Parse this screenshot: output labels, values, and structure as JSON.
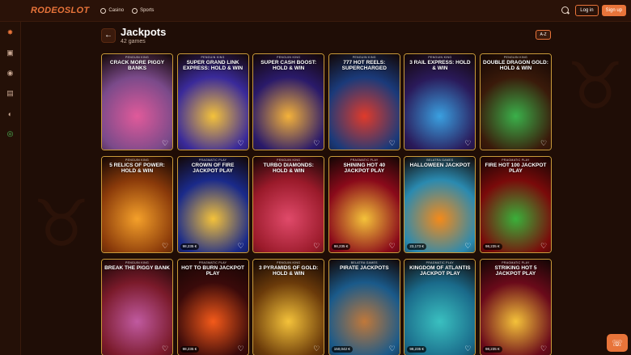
{
  "app": {
    "logo": "RODEOSLOT"
  },
  "nav": [
    {
      "label": "Casino"
    },
    {
      "label": "Sports"
    }
  ],
  "auth": {
    "login": "Log in",
    "signup": "Sign up"
  },
  "page": {
    "title": "Jackpots",
    "subtitle": "42 games",
    "sort_label": "A-Z"
  },
  "games": [
    {
      "provider": "PENGUIN KING",
      "name": "CRACK MORE PIGGY BANKS",
      "jackpot": "",
      "bg": "#7a4a8a",
      "accent": "#e05a9a"
    },
    {
      "provider": "PENGUIN KING",
      "name": "SUPER GRAND LINK EXPRESS: HOLD & WIN",
      "jackpot": "",
      "bg": "#3a2a9a",
      "accent": "#f4c23a"
    },
    {
      "provider": "PENGUIN KING",
      "name": "SUPER CASH BOOST: HOLD & WIN",
      "jackpot": "",
      "bg": "#2a1a6a",
      "accent": "#f4b23a"
    },
    {
      "provider": "PENGUIN KING",
      "name": "777 HOT REELS: SUPERCHARGED",
      "jackpot": "",
      "bg": "#1a3a7a",
      "accent": "#e03a2a"
    },
    {
      "provider": "PENGUIN KING",
      "name": "3 RAIL EXPRESS: HOLD & WIN",
      "jackpot": "",
      "bg": "#2a1a5a",
      "accent": "#3aa0e0"
    },
    {
      "provider": "PENGUIN KING",
      "name": "DOUBLE DRAGON GOLD: HOLD & WIN",
      "jackpot": "",
      "bg": "#3a1a0a",
      "accent": "#3ab04a"
    },
    {
      "provider": "PENGUIN KING",
      "name": "5 RELICS OF POWER: HOLD & WIN",
      "jackpot": "",
      "bg": "#8a3a0a",
      "accent": "#f4a02a"
    },
    {
      "provider": "PRAGMATIC PLAY",
      "name": "CROWN OF FIRE JACKPOT PLAY",
      "jackpot": "98,235 €",
      "bg": "#1a2a8a",
      "accent": "#f4c23a"
    },
    {
      "provider": "PENGUIN KING",
      "name": "TURBO DIAMONDS: HOLD & WIN",
      "jackpot": "",
      "bg": "#9a1a2a",
      "accent": "#e04a6a"
    },
    {
      "provider": "PRAGMATIC PLAY",
      "name": "SHINING HOT 40 JACKPOT PLAY",
      "jackpot": "98,235 €",
      "bg": "#8a0a1a",
      "accent": "#f4c23a"
    },
    {
      "provider": "BELATRA GAMES",
      "name": "HALLOWEEN JACKPOT",
      "jackpot": "23,173 €",
      "bg": "#2a8ab0",
      "accent": "#f48a1a"
    },
    {
      "provider": "PRAGMATIC PLAY",
      "name": "FIRE HOT 100 JACKPOT PLAY",
      "jackpot": "98,235 €",
      "bg": "#7a0a0a",
      "accent": "#3ab03a"
    },
    {
      "provider": "PENGUIN KING",
      "name": "BREAK THE PIGGY BANK",
      "jackpot": "",
      "bg": "#7a1a2a",
      "accent": "#c05aa0"
    },
    {
      "provider": "PRAGMATIC PLAY",
      "name": "HOT TO BURN JACKPOT PLAY",
      "jackpot": "98,235 €",
      "bg": "#3a0a0a",
      "accent": "#f45a1a"
    },
    {
      "provider": "PENGUIN KING",
      "name": "3 PYRAMIDS OF GOLD: HOLD & WIN",
      "jackpot": "",
      "bg": "#6a3a0a",
      "accent": "#f4c23a"
    },
    {
      "provider": "BELATRA GAMES",
      "name": "PIRATE JACKPOTS",
      "jackpot": "150,042 €",
      "bg": "#1a5a8a",
      "accent": "#c0783a"
    },
    {
      "provider": "PRAGMATIC PLAY",
      "name": "KINGDOM OF ATLANTIS JACKPOT PLAY",
      "jackpot": "98,235 €",
      "bg": "#1a6a8a",
      "accent": "#3ac0c0"
    },
    {
      "provider": "PRAGMATIC PLAY",
      "name": "STRIKING HOT 5 JACKPOT PLAY",
      "jackpot": "98,235 €",
      "bg": "#6a0a1a",
      "accent": "#f4c23a"
    }
  ]
}
